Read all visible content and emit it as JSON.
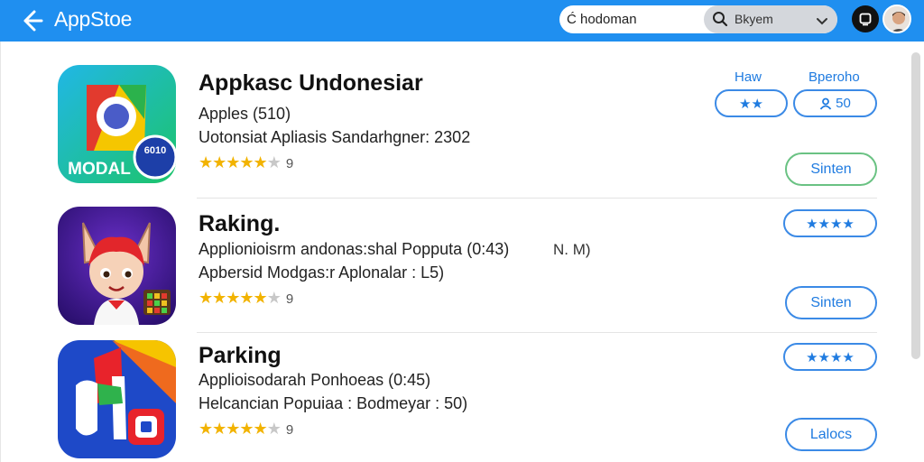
{
  "header": {
    "title": "AppStoe",
    "search": {
      "value": "Ć hodoman",
      "select_value": "Bkyem"
    }
  },
  "columns": {
    "col1": "Haw",
    "col2": "Bperoho"
  },
  "apps": [
    {
      "name": "Appkasc Undonesiar",
      "line1": "Apples (510)",
      "line2": "Uotonsiat Apliasis Sandarhgner: 2302",
      "rating_count": "9",
      "badge_text": "MODAL",
      "badge_sub": "6010",
      "pill_a": "★★",
      "pill_b_icon": "person-icon",
      "pill_b_value": "50",
      "action": "Sinten"
    },
    {
      "name": "Raking.",
      "line1": "Applionioisrm andonas:shal Popputa (0:43)",
      "line2": "Apbersid Modgas:r Aplonalar : L5)",
      "extra": "N. M)",
      "rating_count": "9",
      "pill": "★★★★",
      "action": "Sinten"
    },
    {
      "name": "Parking",
      "line1": "Applioisodarah Ponhoeas (0:45)",
      "line2": "Helcancian Popuiaa : Bodmeyar : 50)",
      "rating_count": "9",
      "pill": "★★★★",
      "action": "Lalocs"
    }
  ],
  "colors": {
    "accent": "#1f8ff0",
    "link": "#1f7be0",
    "star": "#f2b300"
  }
}
